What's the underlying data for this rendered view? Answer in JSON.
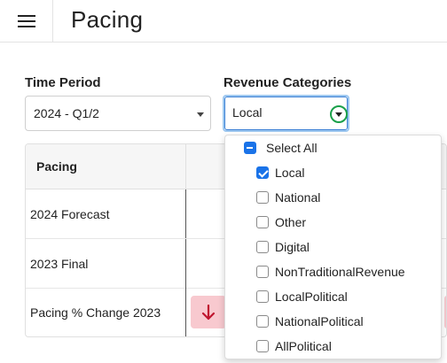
{
  "header": {
    "title": "Pacing"
  },
  "filters": {
    "time_period": {
      "label": "Time Period",
      "value": "2024 - Q1/2"
    },
    "revenue_categories": {
      "label": "Revenue Categories",
      "value": "Local"
    }
  },
  "table": {
    "header": "Pacing",
    "rows": [
      {
        "label": "2024 Forecast"
      },
      {
        "label": "2023 Final"
      },
      {
        "label": "Pacing % Change 2023"
      }
    ]
  },
  "dropdown": {
    "select_all": {
      "label": "Select All",
      "state": "indeterminate"
    },
    "options": [
      {
        "label": "Local",
        "checked": true
      },
      {
        "label": "National",
        "checked": false
      },
      {
        "label": "Other",
        "checked": false
      },
      {
        "label": "Digital",
        "checked": false
      },
      {
        "label": "NonTraditionalRevenue",
        "checked": false
      },
      {
        "label": "LocalPolitical",
        "checked": false
      },
      {
        "label": "NationalPolitical",
        "checked": false
      },
      {
        "label": "AllPolitical",
        "checked": false
      }
    ]
  },
  "colors": {
    "accent": "#1a73e8",
    "decrease_chip": "#f8c9cf",
    "decrease_arrow": "#c0152f",
    "dropdown_toggle_ring": "#1aa04a"
  }
}
